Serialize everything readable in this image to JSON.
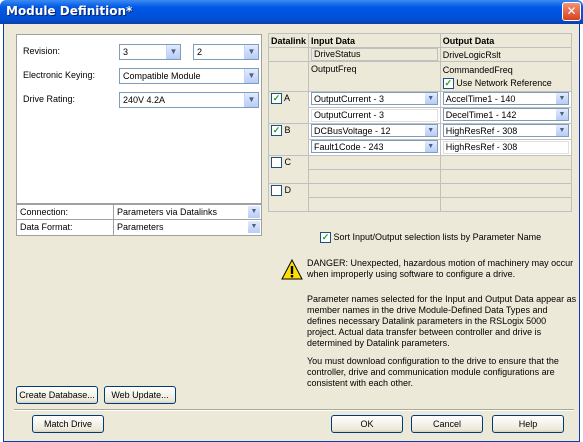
{
  "window": {
    "title": "Module Definition*",
    "close_glyph": "✕"
  },
  "left": {
    "revision_label": "Revision:",
    "revision_major": "3",
    "revision_minor": "2",
    "keying_label": "Electronic Keying:",
    "keying_value": "Compatible Module",
    "rating_label": "Drive Rating:",
    "rating_value": "240V  4.2A",
    "connection_label": "Connection:",
    "connection_value": "Parameters via Datalinks",
    "format_label": "Data Format:",
    "format_value": "Parameters"
  },
  "table": {
    "headers": [
      "Datalink",
      "Input Data",
      "Output Data"
    ],
    "drive_status": "DriveStatus",
    "drive_logic": "DriveLogicRslt",
    "output_freq": "OutputFreq",
    "commanded_freq": "CommandedFreq",
    "use_network_ref": "Use Network Reference",
    "link_a": "A",
    "a_in1": "OutputCurrent - 3",
    "a_out1": "AccelTime1 - 140",
    "a_in2": "OutputCurrent - 3",
    "a_out2": "DecelTime1 - 142",
    "link_b": "B",
    "b_in1": "DCBusVoltage - 12",
    "b_out1": "HighResRef - 308",
    "b_in2": "Fault1Code - 243",
    "b_out2": "HighResRef - 308",
    "link_c": "C",
    "link_d": "D"
  },
  "sort_label": "Sort Input/Output selection lists by Parameter Name",
  "danger": "DANGER: Unexpected, hazardous motion of machinery may occur when improperly using software to configure a drive.",
  "info1": "Parameter names selected for the Input and Output Data appear as member names in the drive Module-Defined Data Types and defines necessary Datalink parameters in the RSLogix 5000 project. Actual data transfer between controller and drive is determined by Datalink parameters.",
  "info2": "You must download configuration to the drive to ensure that the controller, drive and communication module configurations are consistent with each other.",
  "buttons": {
    "create_db": "Create Database...",
    "web_update": "Web Update...",
    "match_drive": "Match Drive",
    "ok": "OK",
    "cancel": "Cancel",
    "help": "Help"
  },
  "icons": {
    "dropdown": "chevron-down-icon",
    "warning": "warning-icon",
    "check": "checkmark-icon"
  }
}
